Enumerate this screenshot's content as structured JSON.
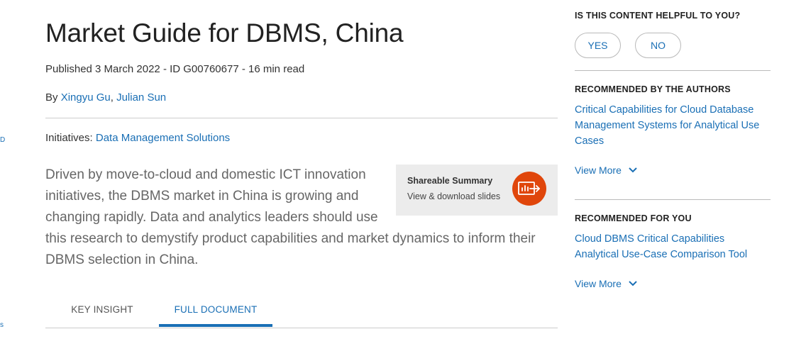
{
  "edge_fragments": [
    "D",
    "s"
  ],
  "document": {
    "title": "Market Guide for DBMS, China",
    "meta": "Published 3 March 2022 - ID G00760677 - 16 min read",
    "by_label": "By ",
    "authors": [
      "Xingyu Gu",
      "Julian Sun"
    ],
    "author_separator": ", ",
    "initiatives_label": "Initiatives: ",
    "initiative_link": "Data Management Solutions",
    "summary": "Driven by move-to-cloud and domestic ICT innovation initiatives, the DBMS market in China is growing and changing rapidly. Data and analytics leaders should use this research to demystify product capabilities and market dynamics to inform their DBMS selection in China."
  },
  "shareable_summary": {
    "title": "Shareable Summary",
    "subtitle": "View & download slides",
    "icon": "presentation-export-icon",
    "icon_bg": "#e0460b"
  },
  "tabs": [
    {
      "label": "KEY INSIGHT",
      "active": false
    },
    {
      "label": "FULL DOCUMENT",
      "active": true
    }
  ],
  "sidebar": {
    "helpful": {
      "heading": "IS THIS CONTENT HELPFUL TO YOU?",
      "yes": "YES",
      "no": "NO"
    },
    "by_authors": {
      "heading": "RECOMMENDED BY THE AUTHORS",
      "links": [
        "Critical Capabilities for Cloud Database Management Systems for Analytical Use Cases"
      ],
      "view_more": "View More"
    },
    "for_you": {
      "heading": "RECOMMENDED FOR YOU",
      "links": [
        "Cloud DBMS Critical Capabilities Analytical Use-Case Comparison Tool"
      ],
      "view_more": "View More"
    }
  },
  "colors": {
    "link": "#1a6fb5",
    "accent_orange": "#e0460b",
    "summary_box_bg": "#ececec"
  }
}
